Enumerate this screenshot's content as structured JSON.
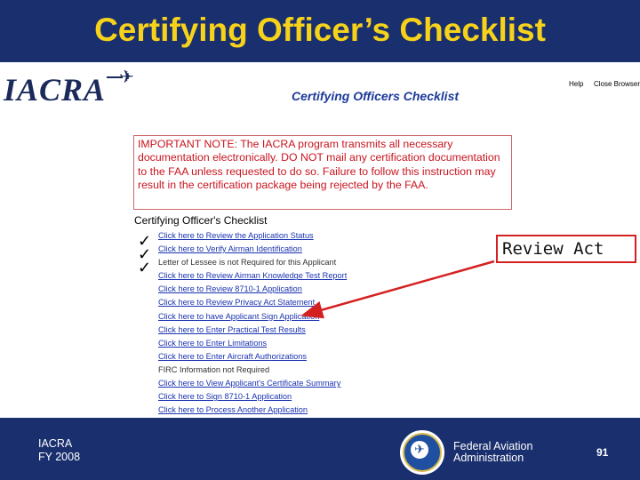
{
  "slide": {
    "title": "Certifying Officer’s Checklist",
    "footer_left_line1": "IACRA",
    "footer_left_line2": "FY 2008",
    "agency_line1": "Federal Aviation",
    "agency_line2": "Administration",
    "page_number": "91"
  },
  "app": {
    "logo": "IACRA",
    "heading": "Certifying Officers Checklist",
    "links": {
      "help": "Help",
      "close_browser": "Close Browser"
    }
  },
  "note": "IMPORTANT NOTE: The IACRA program transmits all necessary documentation electronically. DO NOT mail any certification documentation to the FAA unless requested to do so. Failure to follow this instruction may result in the certification package being rejected by the FAA.",
  "checklist": {
    "title": "Certifying Officer's Checklist",
    "items": [
      {
        "label": "Click here to Review the Application Status",
        "link": true
      },
      {
        "label": "Click here to Verify Airman Identification",
        "link": true
      },
      {
        "label": "Letter of Lessee is not Required for this Applicant",
        "link": false
      },
      {
        "label": "Click here to Review Airman Knowledge Test Report",
        "link": true
      },
      {
        "label": "Click here to Review 8710-1 Application",
        "link": true
      },
      {
        "label": "Click here to Review Privacy Act Statement",
        "link": true
      },
      {
        "label": "Click here to have Applicant Sign Application",
        "link": true
      },
      {
        "label": "Click here to Enter Practical Test Results",
        "link": true
      },
      {
        "label": "Click here to Enter Limitations",
        "link": true
      },
      {
        "label": "Click here to Enter Aircraft Authorizations",
        "link": true
      },
      {
        "label": "FIRC Information not Required",
        "link": false
      },
      {
        "label": "Click here to View Applicant's Certificate Summary",
        "link": true
      },
      {
        "label": "Click here to Sign 8710-1 Application",
        "link": true
      },
      {
        "label": "Click here to Process Another Application",
        "link": true
      }
    ]
  },
  "callout": "Review Act",
  "colors": {
    "title": "#f6d21a",
    "background": "#1a2f6e",
    "note_text": "#c8141e",
    "link": "#1a33b0",
    "arrow": "#d42020"
  },
  "icons": {
    "check": "check-mark-icon",
    "plane": "airplane-icon",
    "seal": "faa-seal-icon"
  }
}
